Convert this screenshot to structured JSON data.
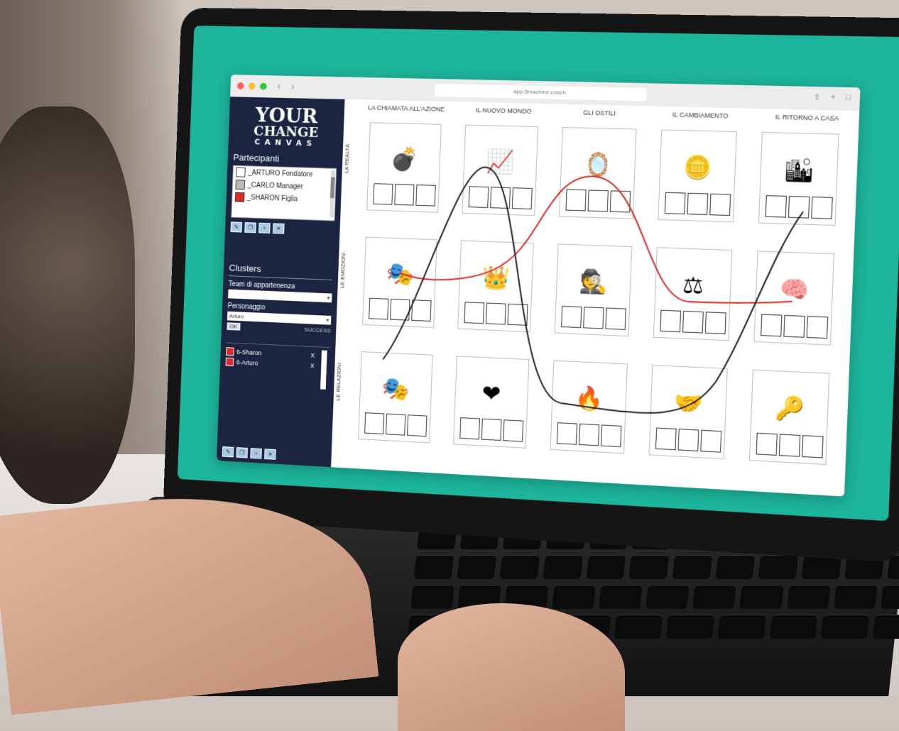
{
  "browser": {
    "url": "app.5machine.coach"
  },
  "sidebar": {
    "logo": {
      "line1": "YOUR",
      "line2": "CHANGE",
      "line3": "CANVAS"
    },
    "participants_title": "Partecipanti",
    "participants": [
      {
        "name": "_ARTURO Fondatore",
        "color": "#ffffff"
      },
      {
        "name": "_CARLO Manager",
        "color": "#bbbbbb"
      },
      {
        "name": "_SHARON Figlia",
        "color": "#d92b2b"
      }
    ],
    "clusters_title": "Clusters",
    "team_label": "Team di appartenenza",
    "team_value": "",
    "character_label": "Personaggio",
    "character_value": "Arturo",
    "ok_label": "OK",
    "success_text": "SUCCESS",
    "cluster_items": [
      {
        "label": "6-Sharon",
        "color": "#d92b2b",
        "remove": "X"
      },
      {
        "label": "6-Arturo",
        "color": "#d92b2b",
        "remove": "X"
      }
    ]
  },
  "canvas": {
    "columns": [
      "LA CHIAMATA ALL'AZIONE",
      "IL NUOVO MONDO",
      "GLI OSTILI",
      "IL CAMBIAMENTO",
      "IL RITORNO A CASA"
    ],
    "rows": [
      "LA REALTÀ",
      "LE EMOZIONI",
      "LE RELAZIONI"
    ],
    "cards": [
      {
        "icon": "bomb-icon",
        "glyph": "💣"
      },
      {
        "icon": "chart-board-icon",
        "glyph": "📈"
      },
      {
        "icon": "mirror-icon",
        "glyph": "🪞"
      },
      {
        "icon": "coins-icon",
        "glyph": "🪙"
      },
      {
        "icon": "city-icon",
        "glyph": "🏙"
      },
      {
        "icon": "masked-faces-icon",
        "glyph": "🎭"
      },
      {
        "icon": "crown-icon",
        "glyph": "👑"
      },
      {
        "icon": "detective-icon",
        "glyph": "🕵"
      },
      {
        "icon": "scales-icon",
        "glyph": "⚖"
      },
      {
        "icon": "mind-icon",
        "glyph": "🧠"
      },
      {
        "icon": "theatre-mask-icon",
        "glyph": "🎭"
      },
      {
        "icon": "birdcage-heart-icon",
        "glyph": "❤"
      },
      {
        "icon": "fire-hands-icon",
        "glyph": "🔥"
      },
      {
        "icon": "handshake-icon",
        "glyph": "🤝"
      },
      {
        "icon": "key-icon",
        "glyph": "🔑"
      }
    ]
  },
  "colors": {
    "screen_bg": "#1db59b",
    "sidebar_bg": "#1b2441",
    "curve_red": "#d92b2b",
    "curve_black": "#222222"
  }
}
